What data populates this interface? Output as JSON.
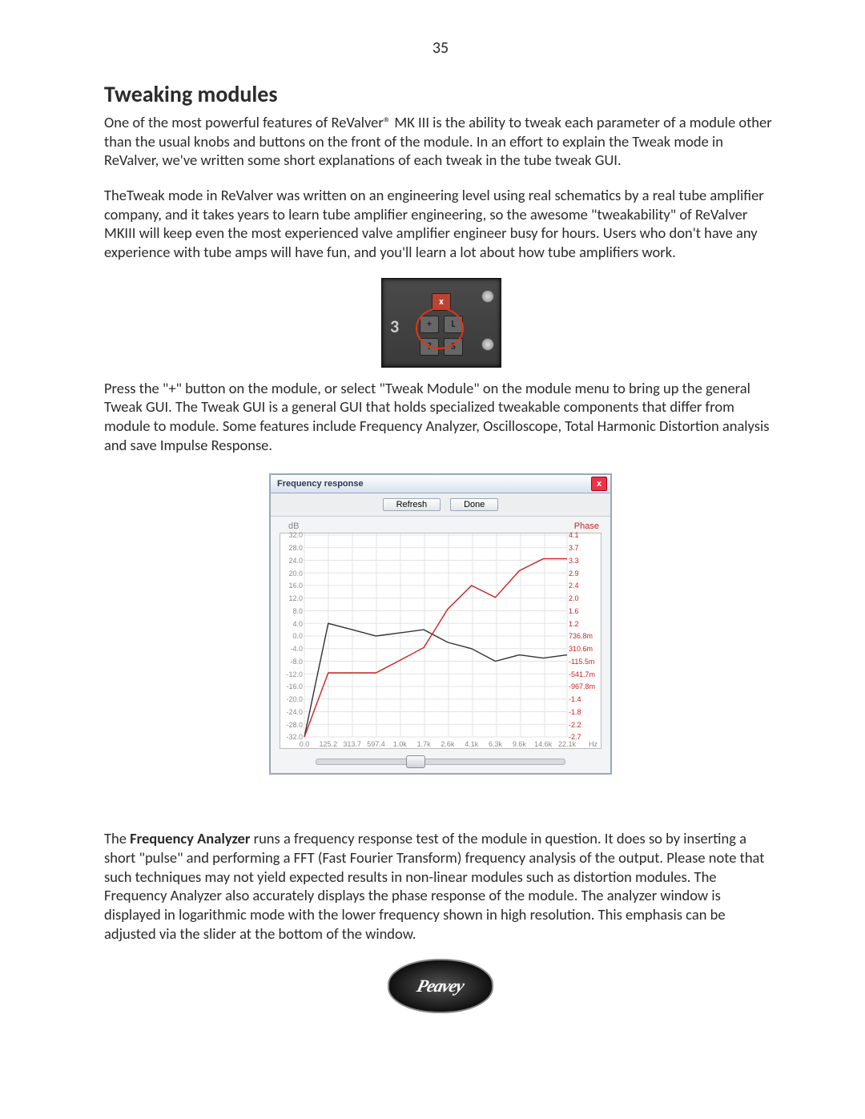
{
  "page_number": "35",
  "heading": "Tweaking modules",
  "para1": "One of the most powerful features of ReValver® MK III is the ability to tweak each parameter of a module other than the usual knobs and buttons on the front of the module.  In an effort to explain the Tweak mode in ReValver, we've written some short explanations of each tweak in the tube tweak GUI.",
  "para2": "TheTweak mode in ReValver was written on an engineering level using real schematics by a real tube amplifier company, and it takes years to learn tube amplifier engineering, so  the awesome \"tweakability\" of ReValver MKIII will keep even the most experienced valve amplifier engineer busy for hours.  Users who don't have any experience with tube amps will have fun, and you'll learn a lot about how tube amplifiers work.",
  "para3": "Press the \"+\" button on the module, or select \"Tweak Module\" on the module menu to bring up the general Tweak GUI.  The Tweak GUI is a general GUI that holds specialized tweakable components that differ from module to module. Some features include Frequency Analyzer, Oscilloscope, Total Harmonic Distortion analysis and save Impulse Response.",
  "para4_lead": "Frequency Analyzer",
  "para4_pre": "The ",
  "para4_rest": " runs a frequency response test of the module in question. It does so by inserting a short \"pulse\" and performing a FFT (Fast Fourier Transform) frequency analysis of the output. Please note that such techniques may not yield expected results in non-linear modules such as distortion modules. The Frequency Analyzer also accurately displays the phase response of the module. The analyzer window is displayed in logarithmic mode with the lower frequency shown in high resolution. This emphasis can be adjusted via the slider at the bottom of the window.",
  "tweak_buttons": {
    "close": "x",
    "plus": "+",
    "L": "L",
    "question": "?",
    "S": "S",
    "digit": "3"
  },
  "freq_window": {
    "title": "Frequency response",
    "close": "x",
    "refresh": "Refresh",
    "done": "Done",
    "y_left_label": "dB",
    "y_right_label": "Phase",
    "x_unit": "Hz"
  },
  "chart_data": {
    "type": "line",
    "title": "Frequency response",
    "xlabel": "Hz",
    "ylabel_left": "dB",
    "ylabel_right": "Phase",
    "ylim_left": [
      -32,
      32
    ],
    "ylim_right": [
      -2.7,
      4.1
    ],
    "x_ticks": [
      "0.0",
      "125.2",
      "313.7",
      "597.4",
      "1.0k",
      "1.7k",
      "2.6k",
      "4.1k",
      "6.3k",
      "9.6k",
      "14.6k",
      "22.1k"
    ],
    "y_ticks_left": [
      "32.0",
      "28.0",
      "24.0",
      "20.0",
      "16.0",
      "12.0",
      "8.0",
      "4.0",
      "0.0",
      "-4.0",
      "-8.0",
      "-12.0",
      "-16.0",
      "-20.0",
      "-24.0",
      "-28.0",
      "-32.0"
    ],
    "y_ticks_right": [
      "4.1",
      "3.7",
      "3.3",
      "2.9",
      "2.4",
      "2.0",
      "1.6",
      "1.2",
      "736.8m",
      "310.6m",
      "-115.5m",
      "-541.7m",
      "-967.8m",
      "-1.4",
      "-1.8",
      "-2.2",
      "-2.7"
    ],
    "series": [
      {
        "name": "dB",
        "color": "#333333",
        "x": [
          "0.0",
          "125.2",
          "313.7",
          "597.4",
          "1.0k",
          "1.7k",
          "2.6k",
          "4.1k",
          "6.3k",
          "9.6k",
          "14.6k",
          "22.1k"
        ],
        "y": [
          -32,
          4,
          2,
          0,
          1,
          2,
          -2,
          -4,
          -8,
          -6,
          -7,
          -6
        ]
      },
      {
        "name": "Phase",
        "color": "#cc2222",
        "x": [
          "0.0",
          "125.2",
          "313.7",
          "597.4",
          "1.0k",
          "1.7k",
          "2.6k",
          "4.1k",
          "6.3k",
          "9.6k",
          "14.6k",
          "22.1k"
        ],
        "y": [
          -2.7,
          -0.54,
          -0.54,
          -0.54,
          -0.12,
          0.31,
          1.6,
          2.4,
          2.0,
          2.9,
          3.3,
          3.3
        ]
      }
    ]
  },
  "logo_text": "Peavey"
}
